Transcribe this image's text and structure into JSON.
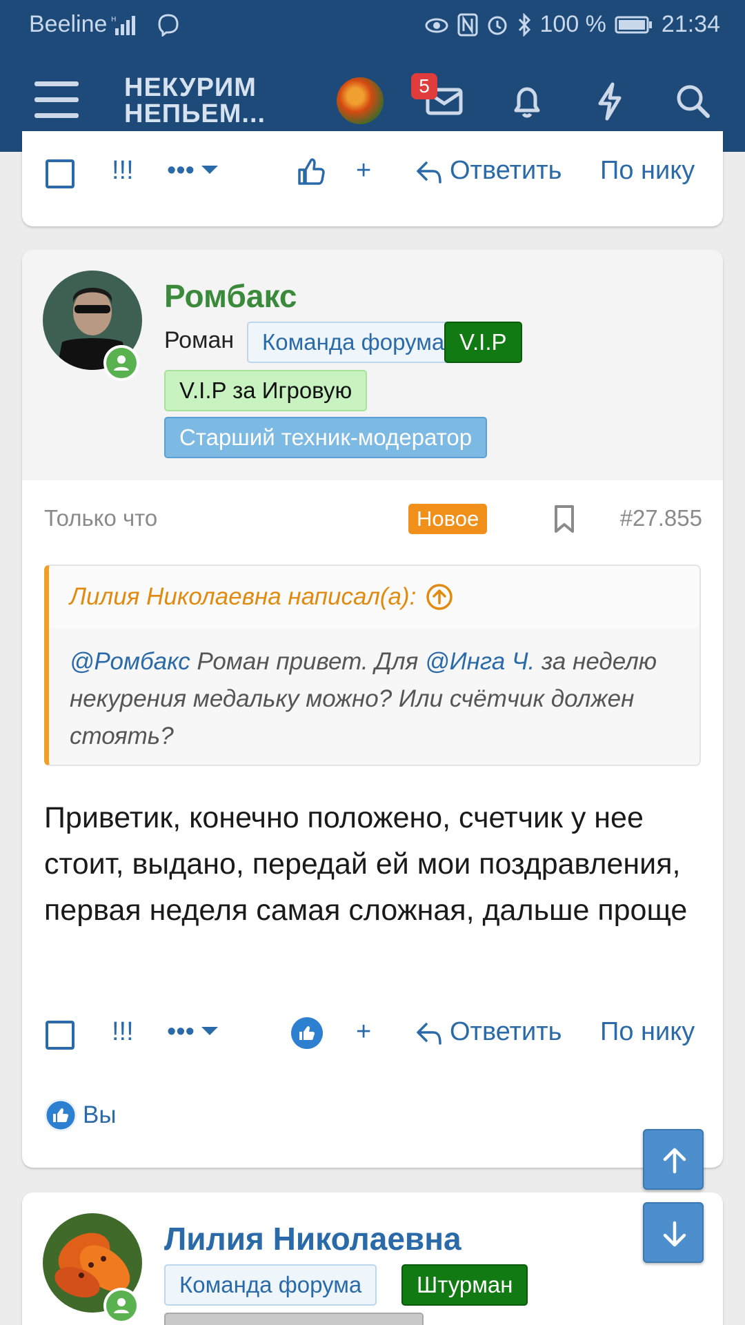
{
  "status_bar": {
    "carrier": "Beeline",
    "battery": "100 %",
    "time": "21:34"
  },
  "header": {
    "logo_line1": "НЕКУРИМ",
    "logo_line2": "НЕПЬЕМ...",
    "unread_badge": "5",
    "icons": [
      "menu-icon",
      "avatar",
      "mail-icon",
      "bell-icon",
      "bolt-icon",
      "search-icon"
    ]
  },
  "actions": {
    "flags": "!!!",
    "more": "•••",
    "plus": "+",
    "reply": "Ответить",
    "by_nick": "По нику"
  },
  "post": {
    "username": "Ромбакс",
    "real_name": "Роман",
    "tags": {
      "team": "Команда форума",
      "vip": "V.I.P",
      "vip_game": "V.I.P за Игровую",
      "tech": "Старший техник-модератор"
    },
    "time": "Только что",
    "new_badge": "Новое",
    "number": "#27.855",
    "quote": {
      "author": "Лилия Николаевна написал(а):",
      "mention1": "@Ромбакс",
      "text1": " Роман привет. Для ",
      "mention2": "@Инга Ч.",
      "text2": " за неделю некурения медальку можно? Или счётчик должен стоять?"
    },
    "body": "Приветик, конечно положено, счетчик у нее стоит, выдано, передай ей мои поздравления, первая неделя самая сложная, дальше проще",
    "reaction_you": "Вы"
  },
  "next_post": {
    "username": "Лилия Николаевна",
    "tags": {
      "team": "Команда форума",
      "shturman": "Штурман"
    }
  },
  "colors": {
    "header_bg": "#1e4a7a",
    "link": "#2a6aa8",
    "username_green": "#3b8a3b",
    "new_badge": "#f0901a"
  }
}
